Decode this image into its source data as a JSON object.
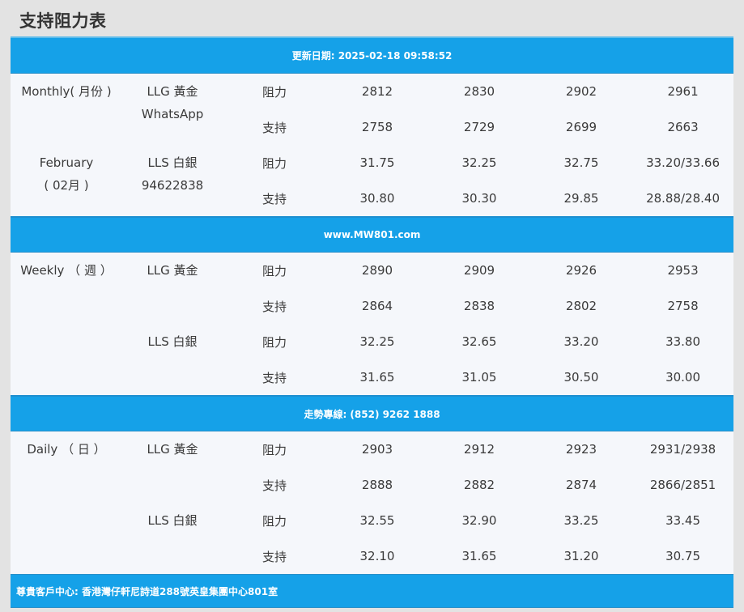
{
  "page": {
    "title": "支持阻力表"
  },
  "banners": {
    "updated": "更新日期: 2025-02-18 09:58:52",
    "website": "www.MW801.com",
    "hotline": "走勢專線: (852) 9262 1888",
    "footer": "尊貴客戶中心: 香港灣仔軒尼詩道288號英皇集團中心801室"
  },
  "sections": [
    {
      "period": [
        "Monthly( 月份 )",
        "February",
        "( 02月 )"
      ],
      "metals": [
        {
          "name": "LLG 黃金",
          "extra": "WhatsApp",
          "rows": [
            {
              "type": "阻力",
              "values": [
                "2812",
                "2830",
                "2902",
                "2961"
              ]
            },
            {
              "type": "支持",
              "values": [
                "2758",
                "2729",
                "2699",
                "2663"
              ]
            }
          ]
        },
        {
          "name": "LLS 白銀",
          "extra": "94622838",
          "rows": [
            {
              "type": "阻力",
              "values": [
                "31.75",
                "32.25",
                "32.75",
                "33.20/33.66"
              ]
            },
            {
              "type": "支持",
              "values": [
                "30.80",
                "30.30",
                "29.85",
                "28.88/28.40"
              ]
            }
          ]
        }
      ]
    },
    {
      "period": [
        "Weekly （ 週 ）"
      ],
      "metals": [
        {
          "name": "LLG 黃金",
          "rows": [
            {
              "type": "阻力",
              "values": [
                "2890",
                "2909",
                "2926",
                "2953"
              ]
            },
            {
              "type": "支持",
              "values": [
                "2864",
                "2838",
                "2802",
                "2758"
              ]
            }
          ]
        },
        {
          "name": "LLS 白銀",
          "rows": [
            {
              "type": "阻力",
              "values": [
                "32.25",
                "32.65",
                "33.20",
                "33.80"
              ]
            },
            {
              "type": "支持",
              "values": [
                "31.65",
                "31.05",
                "30.50",
                "30.00"
              ]
            }
          ]
        }
      ]
    },
    {
      "period": [
        "Daily （ 日 ）"
      ],
      "metals": [
        {
          "name": "LLG 黃金",
          "rows": [
            {
              "type": "阻力",
              "values": [
                "2903",
                "2912",
                "2923",
                "2931/2938"
              ]
            },
            {
              "type": "支持",
              "values": [
                "2888",
                "2882",
                "2874",
                "2866/2851"
              ]
            }
          ]
        },
        {
          "name": "LLS 白銀",
          "rows": [
            {
              "type": "阻力",
              "values": [
                "32.55",
                "32.90",
                "33.25",
                "33.45"
              ]
            },
            {
              "type": "支持",
              "values": [
                "32.10",
                "31.65",
                "31.20",
                "30.75"
              ]
            }
          ]
        }
      ]
    }
  ],
  "colors": {
    "banner": "#15a1e8",
    "background": "#f5f7fb",
    "page": "#e3e3e3"
  }
}
